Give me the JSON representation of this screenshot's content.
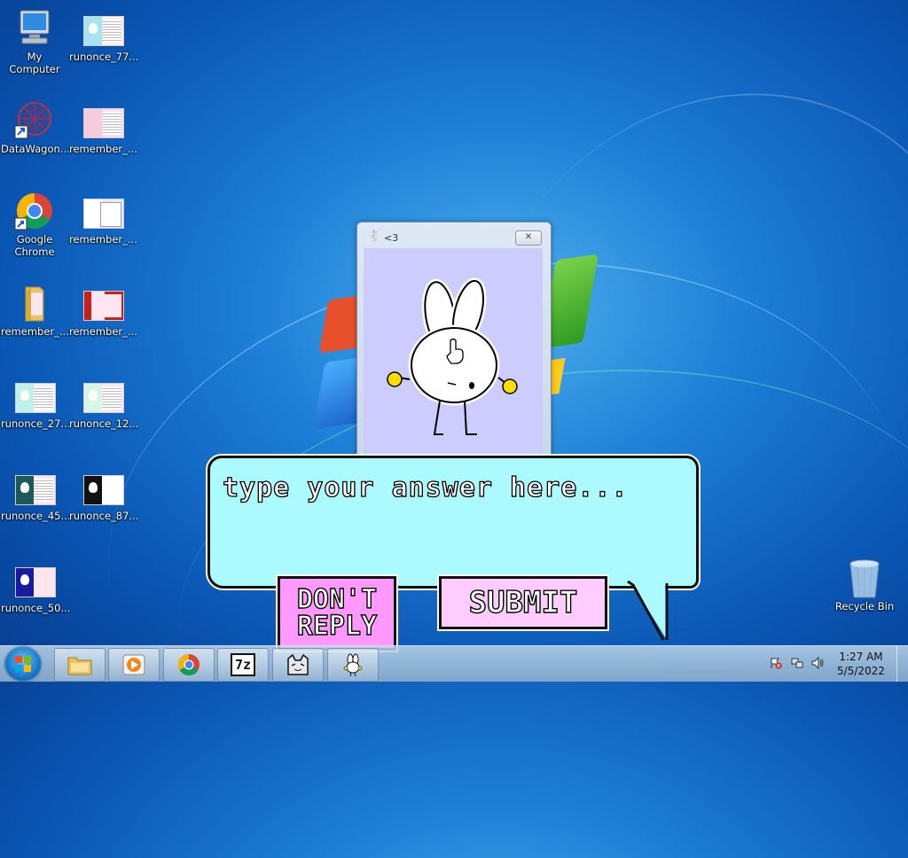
{
  "desktop": {
    "icons": [
      {
        "label": "My Computer",
        "kind": "computer-icon"
      },
      {
        "label": "runonce_77...",
        "kind": "image-file-icon"
      },
      {
        "label": "DataWagon...",
        "kind": "datawagon-shortcut-icon"
      },
      {
        "label": "remember_...",
        "kind": "image-file-icon"
      },
      {
        "label": "Google Chrome",
        "kind": "chrome-icon"
      },
      {
        "label": "remember_...",
        "kind": "image-file-icon"
      },
      {
        "label": "remember_...",
        "kind": "folder-icon"
      },
      {
        "label": "remember_...",
        "kind": "image-file-icon"
      },
      {
        "label": "runonce_27...",
        "kind": "image-file-icon"
      },
      {
        "label": "runonce_12...",
        "kind": "image-file-icon"
      },
      {
        "label": "runonce_45...",
        "kind": "image-file-icon"
      },
      {
        "label": "runonce_87...",
        "kind": "image-file-icon"
      },
      {
        "label": "runonce_50...",
        "kind": "image-file-icon"
      },
      {
        "label": "Recycle Bin",
        "kind": "recycle-bin-icon"
      }
    ]
  },
  "popup": {
    "title": "<3",
    "close_label": "✕",
    "colors": {
      "client": "#ccccff",
      "ear_dots": "#ffdd00"
    }
  },
  "bubble": {
    "placeholder": "type your answer here...",
    "value": "",
    "color": "#aafaff"
  },
  "buttons": {
    "dont_reply": "DON'T\nREPLY",
    "submit": "SUBMIT"
  },
  "taskbar": {
    "items": [
      "start-orb-icon",
      "explorer-icon",
      "media-player-icon",
      "chrome-icon",
      "7zip-icon",
      "cat-app-icon",
      "bunny-app-icon"
    ],
    "sevenzip_label": "7z",
    "clock": {
      "time": "1:27 AM",
      "date": "5/5/2022"
    }
  }
}
